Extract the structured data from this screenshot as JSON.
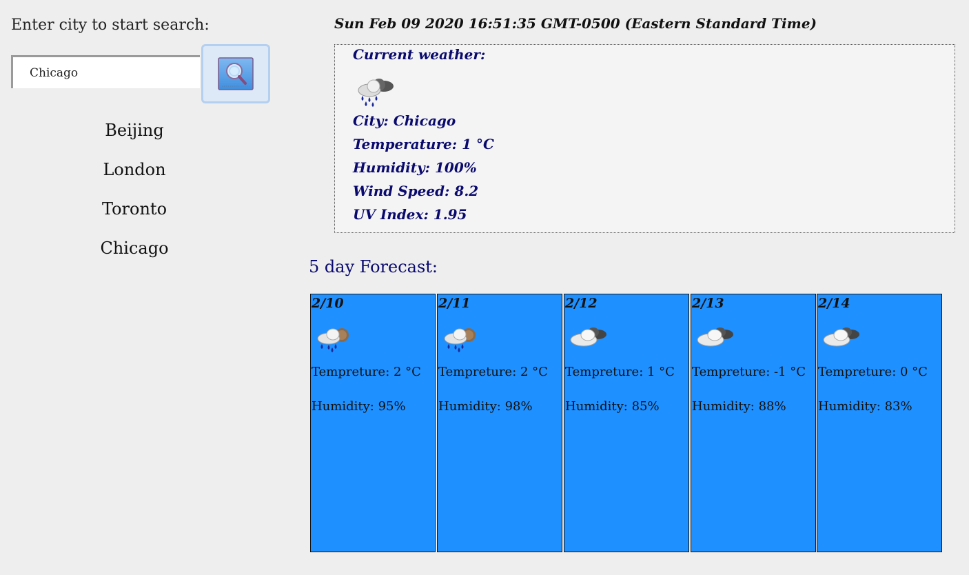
{
  "search": {
    "label": "Enter city to start search:",
    "value": "Chicago",
    "button_icon": "magnifier-icon"
  },
  "history": [
    "Beijing",
    "London",
    "Toronto",
    "Chicago"
  ],
  "datetime": "Sun Feb 09 2020 16:51:35 GMT-0500 (Eastern Standard Time)",
  "current": {
    "heading": "Current weather:",
    "icon": "rain-cloud-icon",
    "city": "City: Chicago",
    "temperature": "Temperature: 1 °C",
    "humidity": "Humidity: 100%",
    "wind": "Wind Speed: 8.2",
    "uv": "UV Index: 1.95"
  },
  "forecast": {
    "heading": "5 day Forecast:",
    "days": [
      {
        "date": "2/10",
        "icon": "rain-cloud-icon",
        "temp": "Tempreture: 2 °C",
        "humidity": "Humidity: 95%"
      },
      {
        "date": "2/11",
        "icon": "rain-cloud-icon",
        "temp": "Tempreture: 2 °C",
        "humidity": "Humidity: 98%"
      },
      {
        "date": "2/12",
        "icon": "cloud-icon",
        "temp": "Tempreture: 1 °C",
        "humidity": "Humidity: 85%"
      },
      {
        "date": "2/13",
        "icon": "cloud-icon",
        "temp": "Tempreture: -1 °C",
        "humidity": "Humidity: 88%"
      },
      {
        "date": "2/14",
        "icon": "cloud-icon",
        "temp": "Tempreture: 0 °C",
        "humidity": "Humidity: 83%"
      }
    ]
  },
  "colors": {
    "background": "#eeeeee",
    "card": "#1e90ff",
    "text_navy": "#0a0a6e"
  }
}
